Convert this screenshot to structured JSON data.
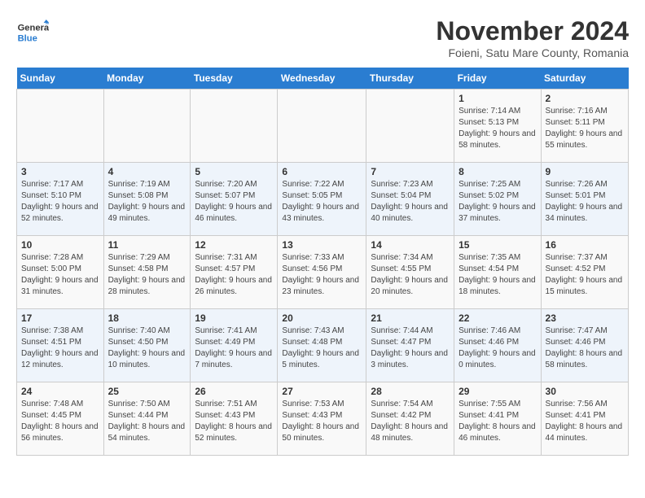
{
  "logo": {
    "line1": "General",
    "line2": "Blue"
  },
  "title": "November 2024",
  "location": "Foieni, Satu Mare County, Romania",
  "days_of_week": [
    "Sunday",
    "Monday",
    "Tuesday",
    "Wednesday",
    "Thursday",
    "Friday",
    "Saturday"
  ],
  "weeks": [
    [
      {
        "day": "",
        "info": ""
      },
      {
        "day": "",
        "info": ""
      },
      {
        "day": "",
        "info": ""
      },
      {
        "day": "",
        "info": ""
      },
      {
        "day": "",
        "info": ""
      },
      {
        "day": "1",
        "info": "Sunrise: 7:14 AM\nSunset: 5:13 PM\nDaylight: 9 hours and 58 minutes."
      },
      {
        "day": "2",
        "info": "Sunrise: 7:16 AM\nSunset: 5:11 PM\nDaylight: 9 hours and 55 minutes."
      }
    ],
    [
      {
        "day": "3",
        "info": "Sunrise: 7:17 AM\nSunset: 5:10 PM\nDaylight: 9 hours and 52 minutes."
      },
      {
        "day": "4",
        "info": "Sunrise: 7:19 AM\nSunset: 5:08 PM\nDaylight: 9 hours and 49 minutes."
      },
      {
        "day": "5",
        "info": "Sunrise: 7:20 AM\nSunset: 5:07 PM\nDaylight: 9 hours and 46 minutes."
      },
      {
        "day": "6",
        "info": "Sunrise: 7:22 AM\nSunset: 5:05 PM\nDaylight: 9 hours and 43 minutes."
      },
      {
        "day": "7",
        "info": "Sunrise: 7:23 AM\nSunset: 5:04 PM\nDaylight: 9 hours and 40 minutes."
      },
      {
        "day": "8",
        "info": "Sunrise: 7:25 AM\nSunset: 5:02 PM\nDaylight: 9 hours and 37 minutes."
      },
      {
        "day": "9",
        "info": "Sunrise: 7:26 AM\nSunset: 5:01 PM\nDaylight: 9 hours and 34 minutes."
      }
    ],
    [
      {
        "day": "10",
        "info": "Sunrise: 7:28 AM\nSunset: 5:00 PM\nDaylight: 9 hours and 31 minutes."
      },
      {
        "day": "11",
        "info": "Sunrise: 7:29 AM\nSunset: 4:58 PM\nDaylight: 9 hours and 28 minutes."
      },
      {
        "day": "12",
        "info": "Sunrise: 7:31 AM\nSunset: 4:57 PM\nDaylight: 9 hours and 26 minutes."
      },
      {
        "day": "13",
        "info": "Sunrise: 7:33 AM\nSunset: 4:56 PM\nDaylight: 9 hours and 23 minutes."
      },
      {
        "day": "14",
        "info": "Sunrise: 7:34 AM\nSunset: 4:55 PM\nDaylight: 9 hours and 20 minutes."
      },
      {
        "day": "15",
        "info": "Sunrise: 7:35 AM\nSunset: 4:54 PM\nDaylight: 9 hours and 18 minutes."
      },
      {
        "day": "16",
        "info": "Sunrise: 7:37 AM\nSunset: 4:52 PM\nDaylight: 9 hours and 15 minutes."
      }
    ],
    [
      {
        "day": "17",
        "info": "Sunrise: 7:38 AM\nSunset: 4:51 PM\nDaylight: 9 hours and 12 minutes."
      },
      {
        "day": "18",
        "info": "Sunrise: 7:40 AM\nSunset: 4:50 PM\nDaylight: 9 hours and 10 minutes."
      },
      {
        "day": "19",
        "info": "Sunrise: 7:41 AM\nSunset: 4:49 PM\nDaylight: 9 hours and 7 minutes."
      },
      {
        "day": "20",
        "info": "Sunrise: 7:43 AM\nSunset: 4:48 PM\nDaylight: 9 hours and 5 minutes."
      },
      {
        "day": "21",
        "info": "Sunrise: 7:44 AM\nSunset: 4:47 PM\nDaylight: 9 hours and 3 minutes."
      },
      {
        "day": "22",
        "info": "Sunrise: 7:46 AM\nSunset: 4:46 PM\nDaylight: 9 hours and 0 minutes."
      },
      {
        "day": "23",
        "info": "Sunrise: 7:47 AM\nSunset: 4:46 PM\nDaylight: 8 hours and 58 minutes."
      }
    ],
    [
      {
        "day": "24",
        "info": "Sunrise: 7:48 AM\nSunset: 4:45 PM\nDaylight: 8 hours and 56 minutes."
      },
      {
        "day": "25",
        "info": "Sunrise: 7:50 AM\nSunset: 4:44 PM\nDaylight: 8 hours and 54 minutes."
      },
      {
        "day": "26",
        "info": "Sunrise: 7:51 AM\nSunset: 4:43 PM\nDaylight: 8 hours and 52 minutes."
      },
      {
        "day": "27",
        "info": "Sunrise: 7:53 AM\nSunset: 4:43 PM\nDaylight: 8 hours and 50 minutes."
      },
      {
        "day": "28",
        "info": "Sunrise: 7:54 AM\nSunset: 4:42 PM\nDaylight: 8 hours and 48 minutes."
      },
      {
        "day": "29",
        "info": "Sunrise: 7:55 AM\nSunset: 4:41 PM\nDaylight: 8 hours and 46 minutes."
      },
      {
        "day": "30",
        "info": "Sunrise: 7:56 AM\nSunset: 4:41 PM\nDaylight: 8 hours and 44 minutes."
      }
    ]
  ]
}
